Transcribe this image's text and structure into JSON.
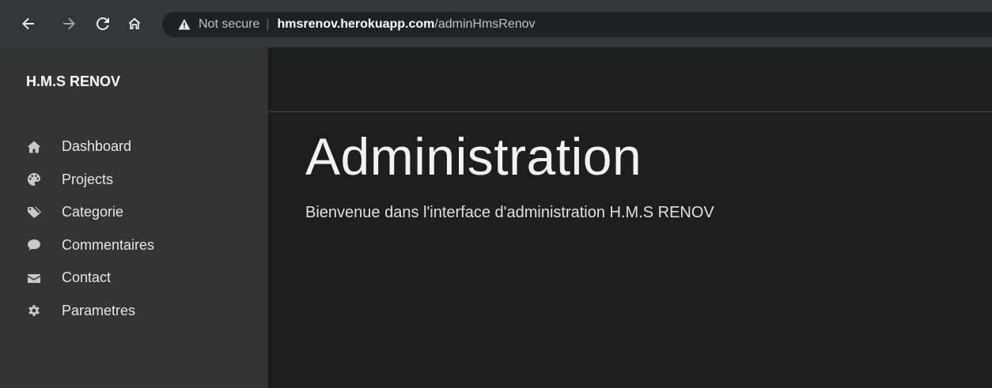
{
  "browser": {
    "back_icon": "arrow-left-icon",
    "forward_icon": "arrow-right-icon",
    "reload_icon": "reload-icon",
    "home_icon": "home-icon",
    "security_label": "Not secure",
    "url_host": "hmsrenov.herokuapp.com",
    "url_path": "/adminHmsRenov"
  },
  "sidebar": {
    "brand": "H.M.S RENOV",
    "items": [
      {
        "label": "Dashboard",
        "icon": "home-icon"
      },
      {
        "label": "Projects",
        "icon": "palette-icon"
      },
      {
        "label": "Categorie",
        "icon": "tags-icon"
      },
      {
        "label": "Commentaires",
        "icon": "comment-icon"
      },
      {
        "label": "Contact",
        "icon": "envelope-icon"
      },
      {
        "label": "Parametres",
        "icon": "gear-icon"
      }
    ]
  },
  "main": {
    "title": "Administration",
    "subtitle": "Bienvenue dans l'interface d'administration H.M.S RENOV"
  },
  "colors": {
    "browser_bar": "#35363a",
    "omnibox": "#202124",
    "sidebar_bg": "#343434",
    "main_bg": "#1e1e1e"
  }
}
